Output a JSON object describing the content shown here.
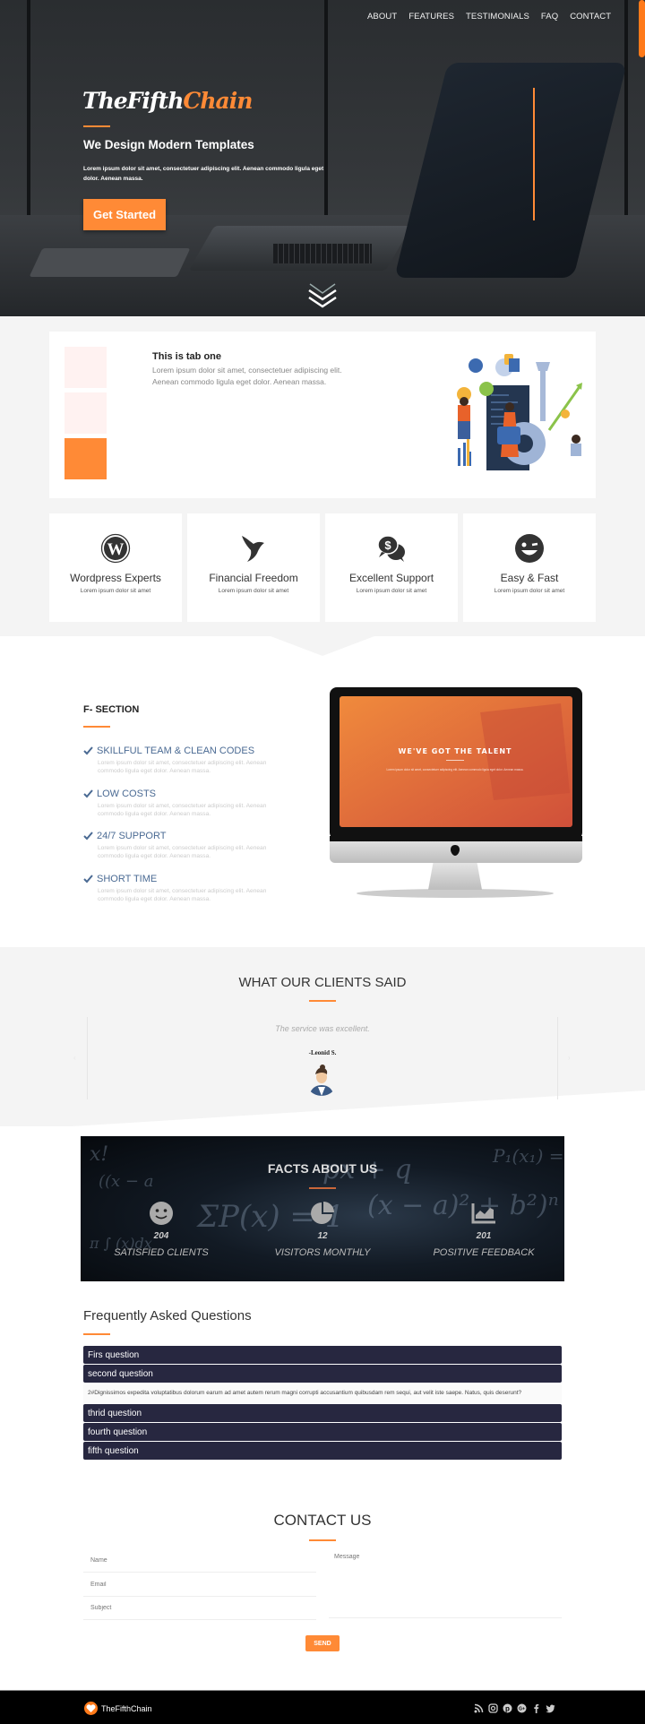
{
  "nav": {
    "items": [
      "ABOUT",
      "FEATURES",
      "TESTIMONIALS",
      "FAQ",
      "CONTACT"
    ]
  },
  "hero": {
    "brand_white": "TheFifth",
    "brand_orange": "Chain",
    "headline": "We Design Modern Templates",
    "text": "Lorem ipsum dolor sit amet, consectetuer adipiscing elit. Aenean commodo ligula eget dolor. Aenean massa.",
    "cta_label": "Get Started",
    "scroll_icon": "double-chevron-down-icon"
  },
  "tabs": {
    "active_index": 2,
    "count": 3,
    "title": "This is tab one",
    "text": "Lorem ipsum dolor sit amet, consectetuer adipiscing elit. Aenean commodo ligula eget dolor. Aenean massa."
  },
  "features": [
    {
      "icon": "wordpress-icon",
      "title": "Wordpress Experts",
      "text": "Lorem ipsum dolor sit amet"
    },
    {
      "icon": "bird-icon",
      "title": "Financial Freedom",
      "text": "Lorem ipsum dolor sit amet"
    },
    {
      "icon": "money-chat-icon",
      "title": "Excellent Support",
      "text": "Lorem ipsum dolor sit amet"
    },
    {
      "icon": "wink-smiley-icon",
      "title": "Easy & Fast",
      "text": "Lorem ipsum dolor sit amet"
    }
  ],
  "fsection": {
    "title": "F- SECTION",
    "items": [
      {
        "title": "SKILLFUL TEAM & CLEAN CODES",
        "text": "Lorem ipsum dolor sit amet, consectetuer adipiscing elit. Aenean commodo ligula eget dolor. Aenean massa."
      },
      {
        "title": "LOW COSTS",
        "text": "Lorem ipsum dolor sit amet, consectetuer adipiscing elit. Aenean commodo ligula eget dolor. Aenean massa."
      },
      {
        "title": "24/7 SUPPORT",
        "text": "Lorem ipsum dolor sit amet, consectetuer adipiscing elit. Aenean commodo ligula eget dolor. Aenean massa."
      },
      {
        "title": "SHORT TIME",
        "text": "Lorem ipsum dolor sit amet, consectetuer adipiscing elit. Aenean commodo ligula eget dolor. Aenean massa."
      }
    ],
    "screen_headline": "WE'VE GOT THE TALENT",
    "screen_text": "Lorem ipsum dolor sit amet, consectetuer adipiscing elit. Aenean commodo ligula eget dolor. Aenean massa."
  },
  "testimonials": {
    "title": "WHAT OUR CLIENTS SAID",
    "quote": "The service was excellent.",
    "author": "-Leonid S.",
    "prev_icon": "‹",
    "next_icon": "›"
  },
  "facts": {
    "title": "FACTS ABOUT US",
    "items": [
      {
        "icon": "smiley-icon",
        "value": "204",
        "label": "SATISFIED CLIENTS"
      },
      {
        "icon": "pie-chart-icon",
        "value": "12",
        "label": "VISITORS MONTHLY"
      },
      {
        "icon": "area-chart-icon",
        "value": "201",
        "label": "POSITIVE FEEDBACK"
      }
    ]
  },
  "faq": {
    "title": "Frequently Asked Questions",
    "questions": [
      "Firs question",
      "second question",
      "thrid question",
      "fourth question",
      "fifth question"
    ],
    "open_index": 1,
    "open_answer": "2#Dignissimos expedita voluptatibus dolorum earum ad amet autem rerum magni corrupti accusantium quibusdam rem sequi, aut velit iste saepe. Natus, quis deserunt?"
  },
  "contact": {
    "title": "CONTACT US",
    "name_placeholder": "Name",
    "email_placeholder": "Email",
    "subject_placeholder": "Subject",
    "message_placeholder": "Message",
    "send_label": "SEND"
  },
  "footer": {
    "brand": "TheFifthChain",
    "socials": [
      "rss-icon",
      "instagram-icon",
      "pinterest-icon",
      "google-plus-icon",
      "facebook-icon",
      "twitter-icon"
    ]
  },
  "colors": {
    "accent": "#ff8a36",
    "faq_bar": "#272740",
    "fsection_heading": "#4a6a93"
  }
}
